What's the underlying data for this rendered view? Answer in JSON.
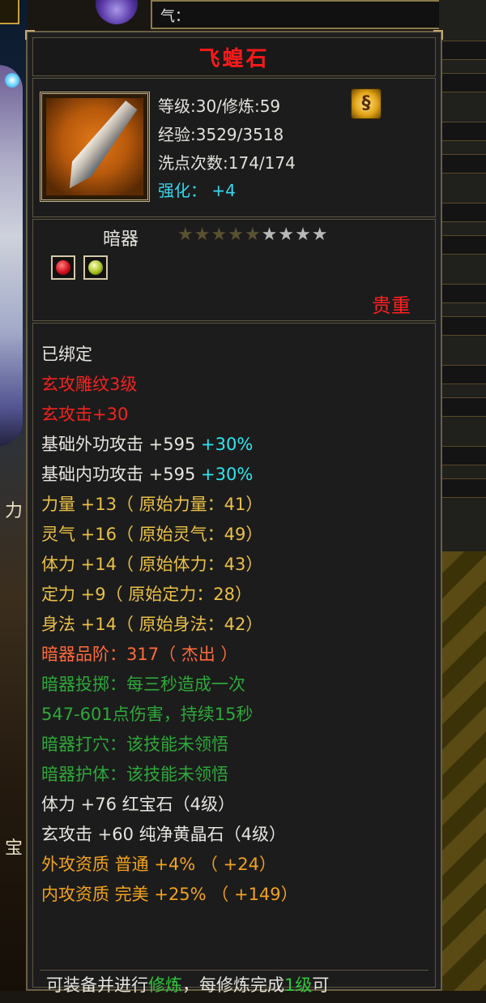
{
  "background": {
    "top_field_label": "气：",
    "left_text_1": "力",
    "left_text_2": "宝"
  },
  "item": {
    "name": "飞蝗石",
    "level_label": "等级",
    "level": "30",
    "cultivation_label": "修炼",
    "cultivation": "59",
    "exp_label": "经验",
    "exp": "3529/3518",
    "wash_label": "洗点次数",
    "wash": "174/174",
    "enhance_label": "强化：",
    "enhance": "+4",
    "type": "暗器",
    "stars_filled": 5,
    "stars_total": 9,
    "rarity": "贵重",
    "gems": [
      "red-gem-icon",
      "yellow-gem-icon"
    ]
  },
  "details": {
    "bound": "已绑定",
    "engraving": "玄攻雕纹3级",
    "xuan_attack": "玄攻击+30",
    "base_outer": "基础外功攻击  +595",
    "base_outer_pct": "+30%",
    "base_inner": "基础内功攻击  +595",
    "base_inner_pct": "+30%",
    "strength": "力量  +13（ 原始力量：41）",
    "spirit": "灵气  +16（ 原始灵气：49）",
    "stamina": "体力  +14（ 原始体力：43）",
    "focus": "定力  +9（ 原始定力：28）",
    "agility": "身法  +14（ 原始身法：42）",
    "grade": "暗器品阶：317（ 杰出 ）",
    "throw_1": "暗器投掷：每三秒造成一次",
    "throw_2": "547-601点伤害，持续15秒",
    "acupoint": "暗器打穴：该技能未领悟",
    "guard": "暗器护体：该技能未领悟",
    "gem_stat_1": "体力  +76  红宝石（4级）",
    "gem_stat_2": "玄攻击  +60  纯净黄晶石（4级）",
    "outer_quality": "外攻资质    普通  +4%  （ +24）",
    "inner_quality": "内攻资质    完美  +25%  （ +149）"
  },
  "footer": {
    "text_a": "可装备并进行",
    "text_b": "修炼",
    "text_c": "，每修炼完成",
    "text_d": "1级",
    "text_e": "可"
  },
  "colors": {
    "title": "#ff1a1a",
    "white": "#e6e4df",
    "red": "#f2231f",
    "cyan": "#2ee6f0",
    "gold": "#eac046",
    "orange": "#ff6a3a",
    "green": "#2ea83a",
    "brown": "#f2a21c"
  }
}
